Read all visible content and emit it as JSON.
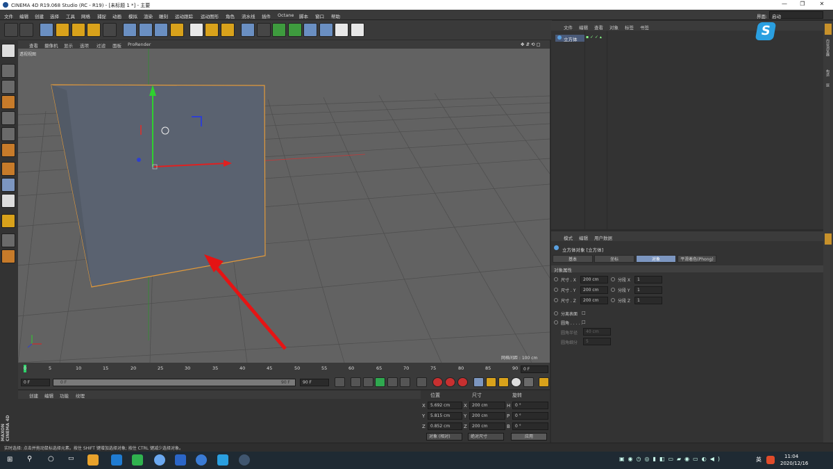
{
  "window": {
    "title": "CINEMA 4D R19.068 Studio (RC - R19) - [未标题 1 *] - 主要",
    "min": "—",
    "max": "❐",
    "close": "✕"
  },
  "menu": [
    "文件",
    "编辑",
    "创建",
    "选择",
    "工具",
    "网格",
    "捕捉",
    "动画",
    "模拟",
    "渲染",
    "雕刻",
    "运动跟踪",
    "运动图形",
    "角色",
    "流水线",
    "插件",
    "Octane",
    "脚本",
    "窗口",
    "帮助"
  ],
  "layout": {
    "label": "界面:",
    "value": "启动"
  },
  "viewport": {
    "menu": [
      "查看",
      "摄像机",
      "显示",
      "选项",
      "过滤",
      "面板",
      "ProRender"
    ],
    "name": "透视视图",
    "grid_info": "网格间距 : 100 cm"
  },
  "timeline": {
    "ticks": [
      "0",
      "5",
      "10",
      "15",
      "20",
      "25",
      "30",
      "35",
      "40",
      "45",
      "50",
      "55",
      "60",
      "65",
      "70",
      "75",
      "80",
      "85",
      "90"
    ],
    "current": "0 F"
  },
  "transport": {
    "start": "0 F",
    "range_start": "0 F",
    "range_end": "90 F",
    "end": "90 F"
  },
  "materials": {
    "menu": [
      "创建",
      "编辑",
      "功能",
      "纹理"
    ]
  },
  "coords": {
    "headers": [
      "位置",
      "尺寸",
      "旋转"
    ],
    "rows": [
      {
        "axis": "X",
        "pos": "5.692 cm",
        "size_axis": "X",
        "size": "200 cm",
        "rot_axis": "H",
        "rot": "0 °"
      },
      {
        "axis": "Y",
        "pos": "5.815 cm",
        "size_axis": "Y",
        "size": "200 cm",
        "rot_axis": "P",
        "rot": "0 °"
      },
      {
        "axis": "Z",
        "pos": "0.852 cm",
        "size_axis": "Z",
        "size": "200 cm",
        "rot_axis": "B",
        "rot": "0 °"
      }
    ],
    "mode": "对象 (相对)",
    "size_mode": "绝对尺寸",
    "apply": "应用"
  },
  "objects": {
    "menu": [
      "文件",
      "编辑",
      "查看",
      "对象",
      "标签",
      "书签"
    ],
    "item": "立方体"
  },
  "attributes": {
    "menu": [
      "模式",
      "编辑",
      "用户数据"
    ],
    "title": "立方体对象 [立方体]",
    "tabs": [
      "基本",
      "坐标",
      "对象",
      "平滑着色(Phong)"
    ],
    "section": "对象属性",
    "rows": [
      {
        "l": "尺寸 . X",
        "v": "200 cm",
        "l2": "分段 X",
        "v2": "1"
      },
      {
        "l": "尺寸 . Y",
        "v": "200 cm",
        "l2": "分段 Y",
        "v2": "1"
      },
      {
        "l": "尺寸 . Z",
        "v": "200 cm",
        "l2": "分段 Z",
        "v2": "1"
      }
    ],
    "sep": "分离表面",
    "fillet": "圆角 . . . . .",
    "fillet_r": "圆角半径",
    "fillet_r_v": "40 cm",
    "fillet_s": "圆角细分",
    "fillet_s_v": "5",
    "on": "✔",
    "off": "□"
  },
  "side_tabs": [
    "对象",
    "内容浏览器",
    "构造",
    "层"
  ],
  "attr_side_tab": "属性",
  "status": "实时选择: 点击并拖动鼠标选择元素。按住 SHIFT 键增加选择对象; 按住 CTRL 键减少选择对象。",
  "brand": {
    "top": "MAXON",
    "bottom": "CINEMA 4D"
  },
  "taskbar": {
    "time": "11:04",
    "date": "2020/12/16",
    "ime": "英"
  }
}
